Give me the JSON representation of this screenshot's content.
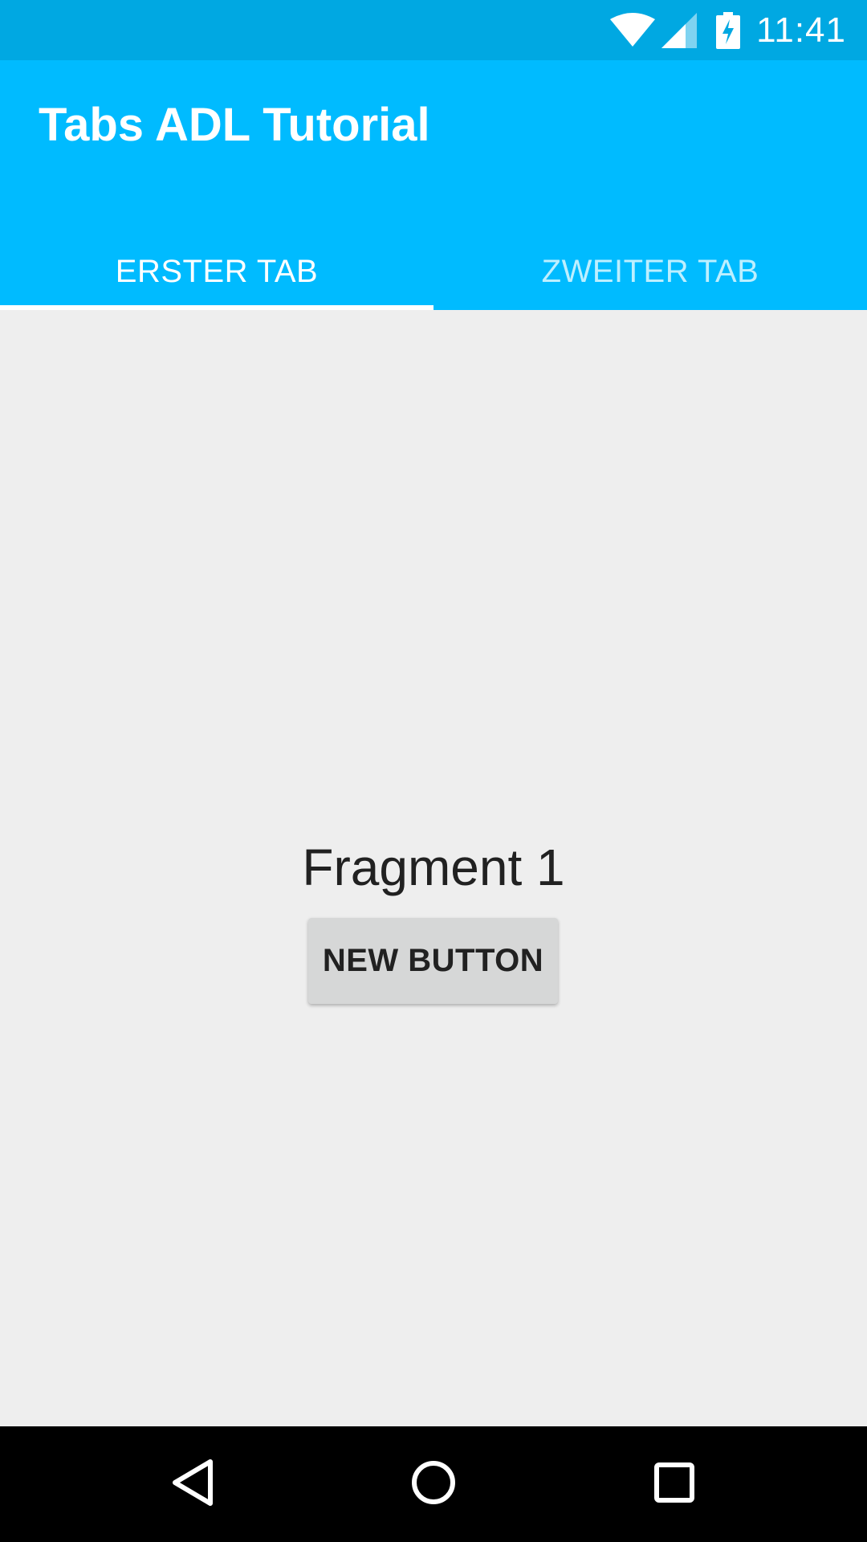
{
  "status_bar": {
    "time": "11:41",
    "icons": [
      "wifi-icon",
      "signal-icon",
      "battery-charging-icon"
    ]
  },
  "app_bar": {
    "title": "Tabs ADL Tutorial",
    "tabs": [
      {
        "label": "ERSTER TAB",
        "active": true
      },
      {
        "label": "ZWEITER TAB",
        "active": false
      }
    ]
  },
  "content": {
    "fragment_label": "Fragment 1",
    "button_label": "NEW BUTTON"
  },
  "nav_bar": {
    "icons": [
      "back-icon",
      "home-icon",
      "recents-icon"
    ]
  },
  "colors": {
    "status_bar": "#00a8e2",
    "app_bar": "#00bbff",
    "background": "#eeeeee",
    "button": "#d6d7d7",
    "nav_bar": "#000000"
  }
}
